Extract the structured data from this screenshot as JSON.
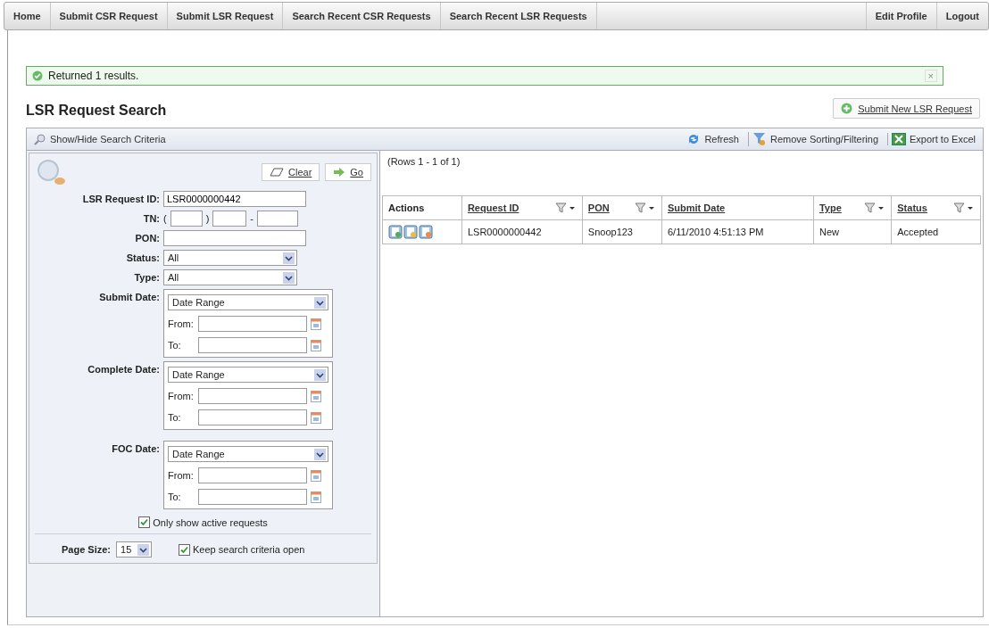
{
  "nav": {
    "left": [
      {
        "label": "Home",
        "selected": false
      },
      {
        "label": "Submit CSR Request",
        "selected": false
      },
      {
        "label": "Submit LSR Request",
        "selected": false
      },
      {
        "label": "Search Recent CSR Requests",
        "selected": false
      },
      {
        "label": "Search Recent LSR Requests",
        "selected": false
      }
    ],
    "right": [
      {
        "label": "Edit Profile"
      },
      {
        "label": "Logout"
      }
    ]
  },
  "message": {
    "text": "Returned 1 results.",
    "close": "×"
  },
  "title": "LSR Request Search",
  "new_button": "Submit New LSR Request",
  "toolbar": {
    "toggle": "Show/Hide Search Criteria",
    "actions": [
      {
        "kind": "refresh",
        "label": "Refresh"
      },
      {
        "kind": "filter",
        "label": "Remove Sorting/Filtering"
      },
      {
        "kind": "excel",
        "label": "Export to Excel"
      }
    ]
  },
  "criteria": {
    "clear": "Clear",
    "go": "Go",
    "request_id": {
      "label": "LSR Request ID:",
      "value": "LSR0000000442"
    },
    "tn": {
      "label": "TN:",
      "open": "(",
      "close": ")",
      "dash": "-"
    },
    "pon": {
      "label": "PON:"
    },
    "status": {
      "label": "Status:",
      "value": "All"
    },
    "type": {
      "label": "Type:",
      "value": "All"
    },
    "date_filters": [
      {
        "label": "Submit Date:",
        "range": "Date Range",
        "from": "From:",
        "to": "To:"
      },
      {
        "label": "Complete Date:",
        "range": "Date Range",
        "from": "From:",
        "to": "To:"
      },
      {
        "label": "FOC Date:",
        "range": "Date Range",
        "from": "From:",
        "to": "To:"
      }
    ],
    "only_active": {
      "label": "Only show active requests",
      "checked": true
    },
    "page_size": {
      "label": "Page Size:",
      "value": "15"
    },
    "keep_open": {
      "label": "Keep search criteria open",
      "checked": true
    }
  },
  "table": {
    "rows_info": "(Rows 1 - 1 of 1)",
    "columns": [
      {
        "label": "Actions",
        "kind": "plain",
        "filterable": false
      },
      {
        "label": "Request ID",
        "kind": "sortable",
        "filterable": true
      },
      {
        "label": "PON",
        "kind": "sortable",
        "filterable": true
      },
      {
        "label": "Submit Date",
        "kind": "sortable",
        "filterable": false
      },
      {
        "label": "Type",
        "kind": "sortable",
        "filterable": true
      },
      {
        "label": "Status",
        "kind": "sortable",
        "filterable": true
      }
    ],
    "rows": [
      {
        "cells": [
          "",
          "LSR0000000442",
          "Snoop123",
          "6/11/2010 4:51:13 PM",
          "New",
          "Accepted"
        ]
      }
    ]
  }
}
